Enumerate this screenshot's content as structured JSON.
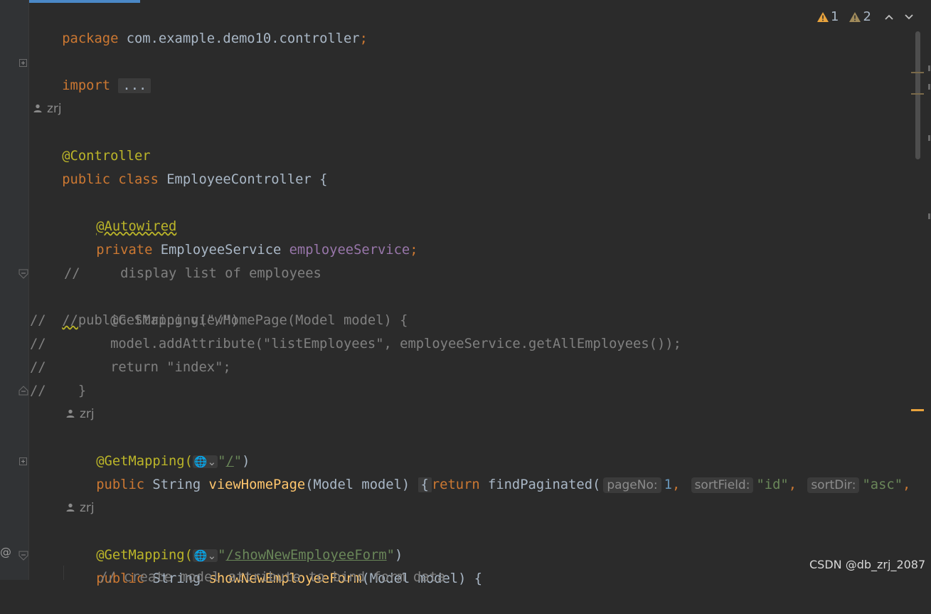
{
  "colors": {
    "keyword": "#cc7832",
    "annotation": "#bbb529",
    "field": "#9876aa",
    "method": "#ffc66d",
    "string": "#6a8759",
    "number": "#6897bb",
    "comment": "#808080",
    "text": "#a9b7c6",
    "background": "#2b2b2b",
    "warning": "#e8a33d"
  },
  "inspections": {
    "warning_count": "1",
    "weak_warning_count": "2",
    "icons": [
      "warning-triangle-icon",
      "weak-warning-triangle-icon",
      "chevron-up-icon",
      "chevron-down-icon"
    ]
  },
  "code": {
    "l1": {
      "kw": "package",
      "rest": " com.example.demo10.controller",
      "semi": ";"
    },
    "l2": {
      "kw": "import",
      "fold": "..."
    },
    "author1": "zrj",
    "l3": {
      "ann": "@Controller"
    },
    "l4": {
      "kw1": "public",
      "kw2": "class",
      "name": " EmployeeController {"
    },
    "l5": {
      "ann": "@Autowired"
    },
    "l6": {
      "kw": "private",
      "type": " EmployeeService ",
      "field": "employeeService",
      "semi": ";"
    },
    "c1": "//     display list of employees",
    "c2a": "//",
    "c2b": "    @GetMapping(\"/\")",
    "c3": "//    public String viewHomePage(Model model) {",
    "c4": "//        model.addAttribute(\"listEmployees\", employeeService.getAllEmployees());",
    "c5": "//        return \"index\";",
    "c6": "//    }",
    "author2": "zrj",
    "l7": {
      "ann": "@GetMapping(",
      "q1": "\"",
      "path": "/",
      "q2": "\"",
      "close": ")"
    },
    "l8": {
      "kw": "public",
      "type": " String ",
      "fn": "viewHomePage",
      "args": "(Model model) ",
      "brace": "{",
      "ret": "return",
      "call": " findPaginated(",
      "hint1": "pageNo:",
      "num": "1",
      "comma1": ",",
      "hint2": "sortField:",
      "s1": "\"id\"",
      "comma2": ",",
      "hint3": "sortDir:",
      "s2": "\"asc\"",
      "comma3": ","
    },
    "author3": "zrj",
    "l9": {
      "ann": "@GetMapping(",
      "q1": "\"",
      "path": "/showNewEmployeeForm",
      "q2": "\"",
      "close": ")"
    },
    "l10": {
      "kw": "public",
      "type": " String ",
      "fn": "showNewEmployeeForm",
      "args": "(Model model) {"
    },
    "l11": "// create model attribute to bind form data"
  },
  "gutter_symbol": "@",
  "watermark": "CSDN @db_zrj_2087"
}
